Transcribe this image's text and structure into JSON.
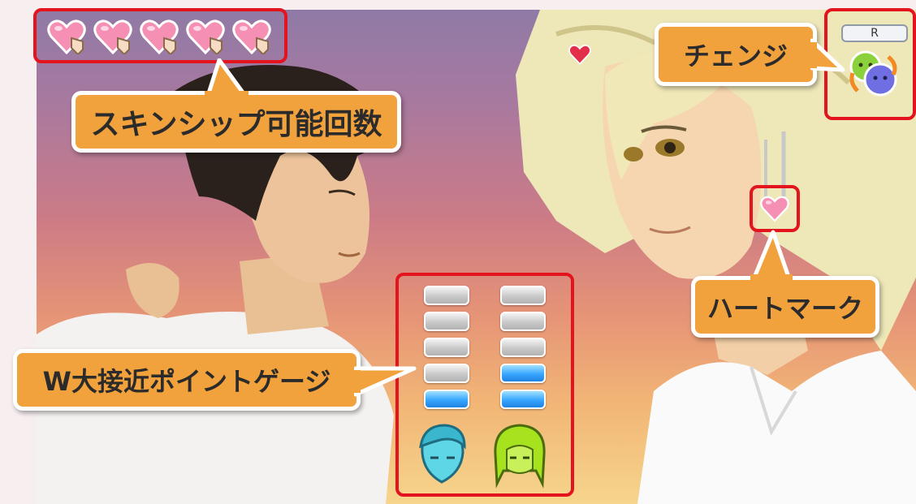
{
  "hud": {
    "skinship_hearts_remaining": 5,
    "change_button": {
      "key_label": "R"
    },
    "gauges": {
      "left_character": {
        "filled": 1,
        "total": 5,
        "color": "#38a6ff"
      },
      "right_character": {
        "filled": 2,
        "total": 5,
        "color": "#38a6ff"
      }
    }
  },
  "callouts": {
    "skinship_count": "スキンシップ可能回数",
    "change": "チェンジ",
    "heart_mark": "ハートマーク",
    "w_approach_gauge": "W大接近ポイントゲージ"
  },
  "colors": {
    "highlight": "#e3141d",
    "callout_fill": "#f2a23c",
    "heart_pink": "#f58fb4"
  },
  "icons": [
    "heart-hand-icon",
    "change-character-icon",
    "heart-mark-icon",
    "left-character-face-icon",
    "right-character-face-icon"
  ]
}
